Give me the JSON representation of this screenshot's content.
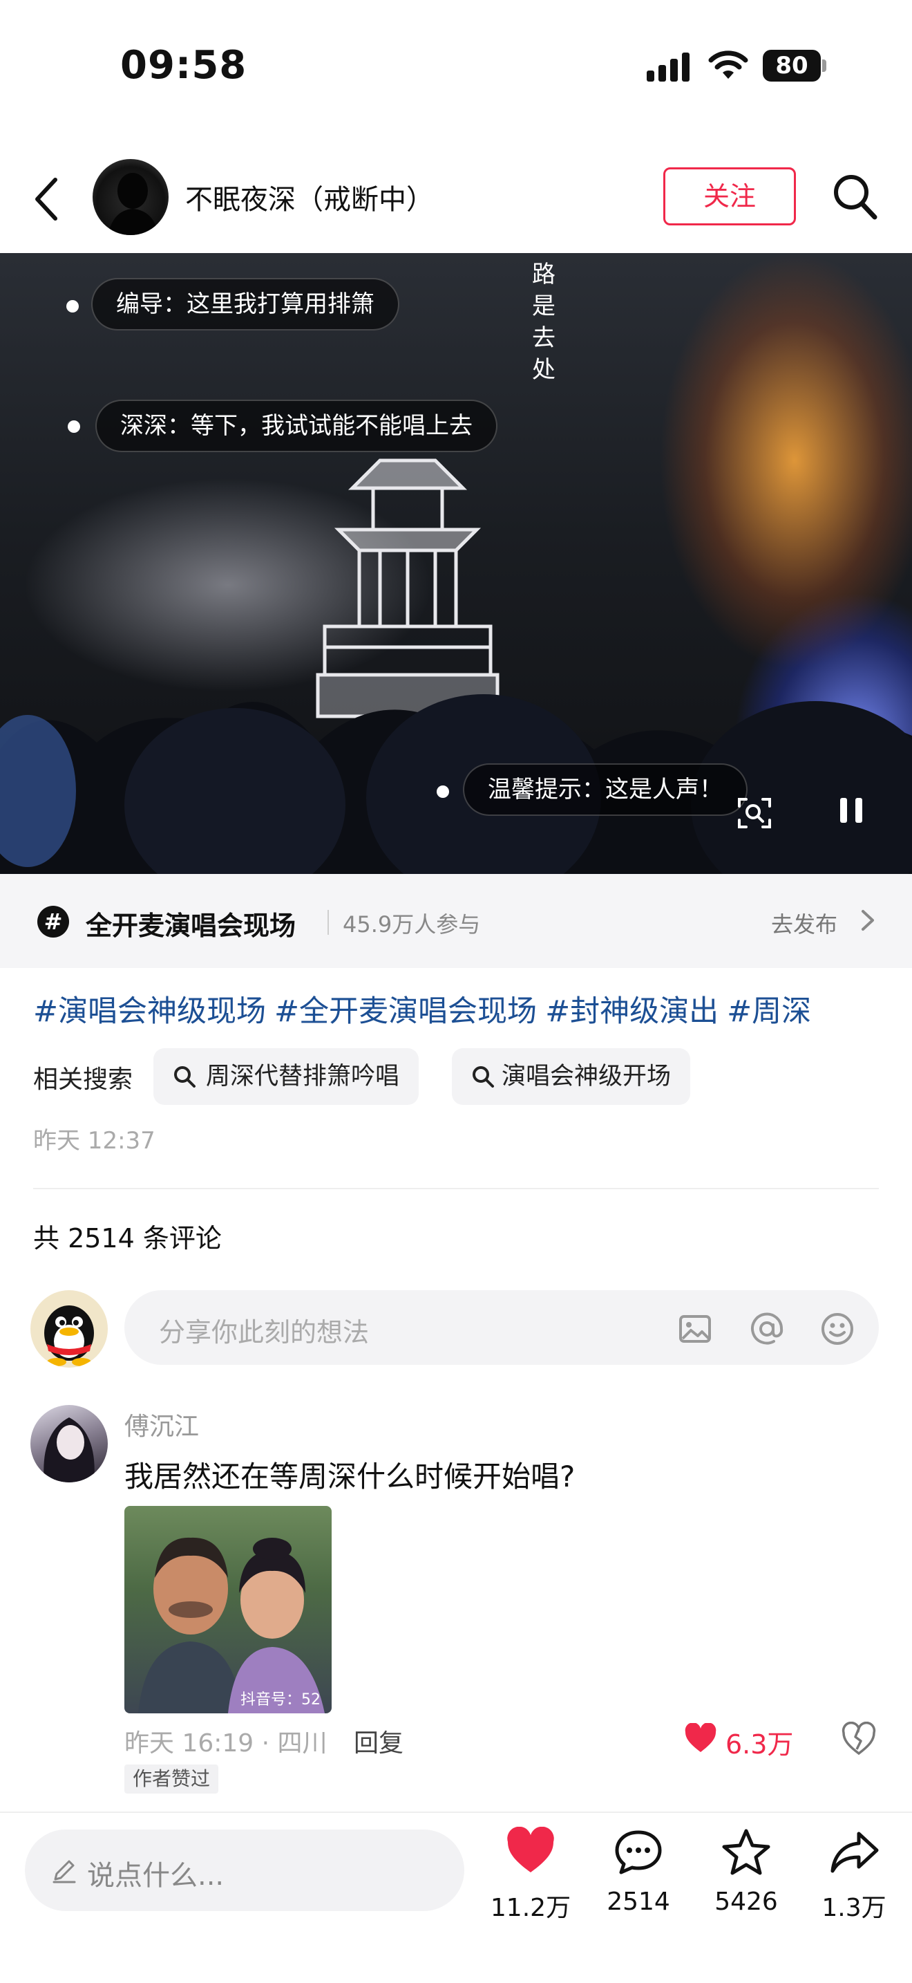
{
  "status_bar": {
    "time": "09:58",
    "battery": "80"
  },
  "header": {
    "username": "不眠夜深（戒断中）",
    "follow_label": "关注"
  },
  "video": {
    "bubbles": [
      "编导：这里我打算用排箫",
      "深深：等下，我试试能不能唱上去",
      "温馨提示：这是人声！"
    ],
    "vertical_text": "路 是去处"
  },
  "topic": {
    "title": "全开麦演唱会现场",
    "participants": "45.9万人参与",
    "publish_label": "去发布"
  },
  "hashtags": [
    "#演唱会神级现场",
    "#全开麦演唱会现场",
    "#封神级演出",
    "#周深"
  ],
  "related": {
    "label": "相关搜索",
    "chips": [
      "周深代替排箫吟唱",
      "演唱会神级开场"
    ]
  },
  "post_time": "昨天 12:37",
  "comments": {
    "total_label": "共 2514 条评论",
    "input_placeholder": "分享你此刻的想法",
    "items": [
      {
        "name": "傅沉江",
        "text": "我居然还在等周深什么时候开始唱?",
        "image_watermark": "抖音号：52",
        "meta": "昨天 16:19 · 四川",
        "reply_label": "回复",
        "likes": "6.3万",
        "badge": "作者赞过"
      }
    ]
  },
  "bottom_bar": {
    "say_placeholder": "说点什么...",
    "likes": "11.2万",
    "comments": "2514",
    "favorites": "5426",
    "shares": "1.3万"
  },
  "colors": {
    "accent": "#f0284a",
    "hashtag": "#1c4f94"
  }
}
